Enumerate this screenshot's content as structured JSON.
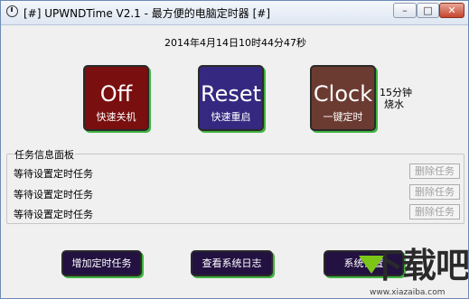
{
  "window": {
    "title": "[#] UPWNDTime V2.1 - 最方便的电脑定时器 [#]",
    "controls": {
      "minimize": "–",
      "maximize": "□",
      "close": "✕"
    }
  },
  "datetime": "2014年4月14日10时44分47秒",
  "actions": {
    "off": {
      "label": "Off",
      "sub": "快速关机",
      "color": "#7a0f0f"
    },
    "reset": {
      "label": "Reset",
      "sub": "快速重启",
      "color": "#352880"
    },
    "clock": {
      "label": "Clock",
      "sub": "一键定时",
      "color": "#6b3b32"
    }
  },
  "clock_note": {
    "line1": "15分钟",
    "line2": "烧水"
  },
  "task_panel": {
    "title": "任务信息面板",
    "rows": [
      {
        "status": "等待设置定时任务",
        "delete_label": "删除任务"
      },
      {
        "status": "等待设置定时任务",
        "delete_label": "删除任务"
      },
      {
        "status": "等待设置定时任务",
        "delete_label": "删除任务"
      }
    ]
  },
  "bottom_buttons": {
    "add_task": "增加定时任务",
    "view_log": "查看系统日志",
    "system_settings": "系统设置"
  },
  "watermark": {
    "text": "下载吧",
    "url": "www.xiazaiba.com"
  },
  "colors": {
    "accent_shadow": "#3fb33f",
    "bottom_button_bg": "#221141"
  }
}
